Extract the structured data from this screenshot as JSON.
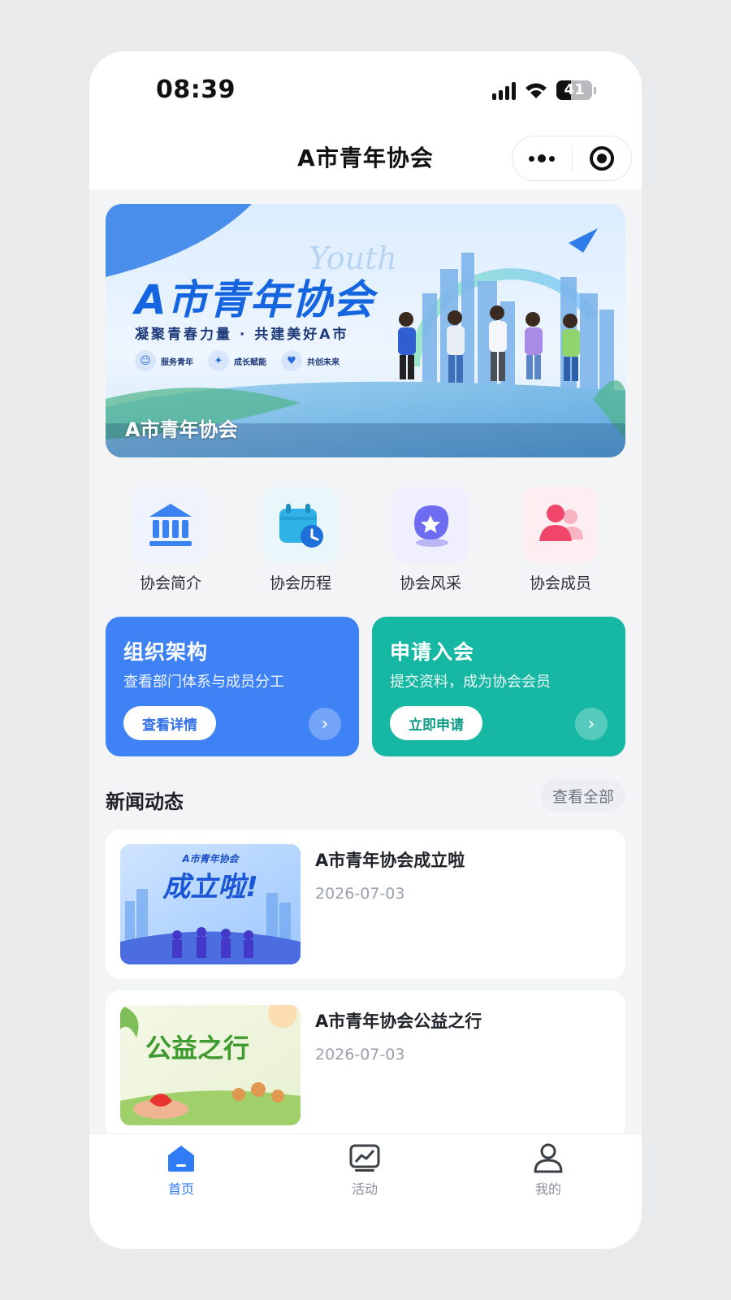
{
  "status_bar": {
    "time": "08:39",
    "battery": "41"
  },
  "nav": {
    "title": "A市青年协会",
    "more_icon": "more-dots-icon",
    "close_icon": "target-circle-icon"
  },
  "banner": {
    "headline": "A市青年协会",
    "script_word": "Youth",
    "slogan": "凝聚青春力量 · 共建美好A市",
    "badges": [
      {
        "label": "服务青年",
        "icon": "user-icon"
      },
      {
        "label": "成长赋能",
        "icon": "bulb-icon"
      },
      {
        "label": "共创未来",
        "icon": "heart-icon"
      }
    ],
    "caption": "A市青年协会"
  },
  "quick_links": [
    {
      "label": "协会简介",
      "icon": "bank-icon",
      "bg": "#eef3fe"
    },
    {
      "label": "协会历程",
      "icon": "calendar-clock-icon",
      "bg": "#e9f7fb"
    },
    {
      "label": "协会风采",
      "icon": "star-badge-icon",
      "bg": "#efeffd"
    },
    {
      "label": "协会成员",
      "icon": "members-icon",
      "bg": "#fdeef2"
    }
  ],
  "cards": [
    {
      "title": "组织架构",
      "subtitle": "查看部门体系与成员分工",
      "button": "查看详情",
      "color": "#3f82f5"
    },
    {
      "title": "申请入会",
      "subtitle": "提交资料，成为协会会员",
      "button": "立即申请",
      "color": "#16b8a4"
    }
  ],
  "news": {
    "title": "新闻动态",
    "view_all": "查看全部",
    "items": [
      {
        "title": "A市青年协会成立啦",
        "date": "2026-07-03",
        "thumb_title": "成立啦!",
        "thumb_top": "A市青年协会"
      },
      {
        "title": "A市青年协会公益之行",
        "date": "2026-07-03",
        "thumb_title": "公益之行"
      }
    ]
  },
  "tabbar": [
    {
      "label": "首页",
      "icon": "home-icon",
      "active": true
    },
    {
      "label": "活动",
      "icon": "chart-icon",
      "active": false
    },
    {
      "label": "我的",
      "icon": "person-icon",
      "active": false
    }
  ]
}
